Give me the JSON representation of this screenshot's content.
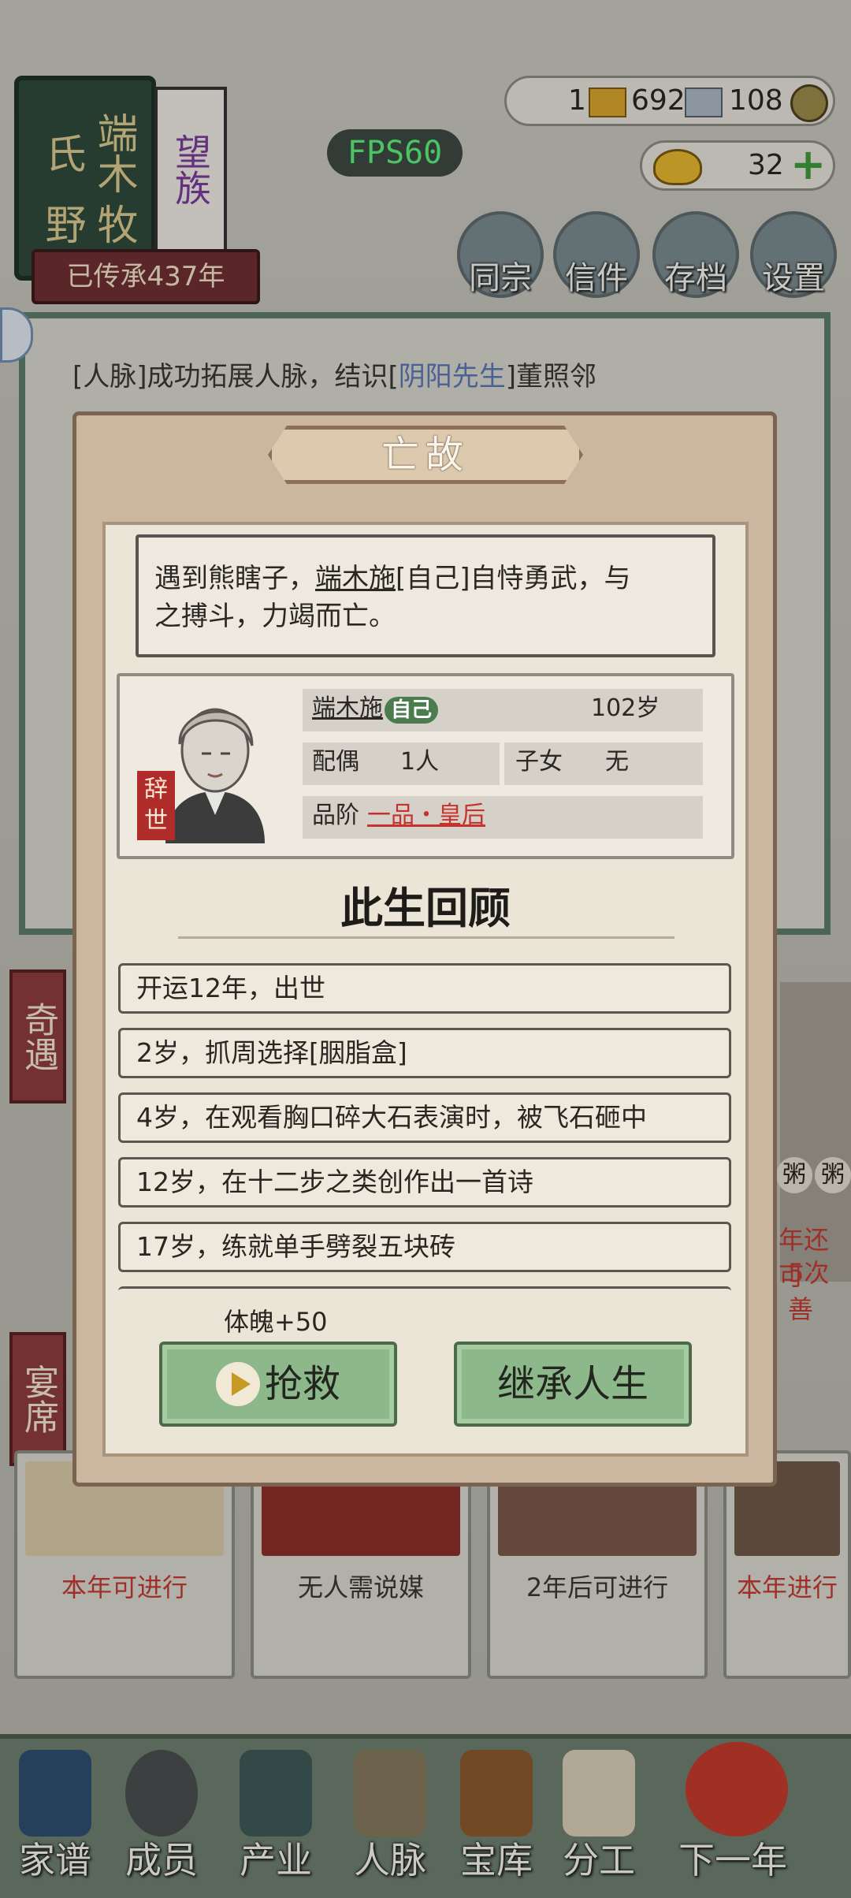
{
  "family": {
    "surname": "端木氏",
    "place": "牧野",
    "rank": "望族",
    "heritage": "已传承437年"
  },
  "fps": "FPS60",
  "resources": {
    "gold_bars": "1",
    "silver": "692",
    "copper": "108",
    "ingots": "32"
  },
  "top_buttons": [
    "同宗",
    "信件",
    "存档",
    "设置"
  ],
  "log": {
    "prefix": "[人脉]成功拓展人脉，结识[",
    "highlight": "阴阳先生",
    "suffix": "]董照邻"
  },
  "side_tabs": [
    "奇遇",
    "宴席"
  ],
  "bg_cards": [
    {
      "text": "本年可进行"
    },
    {
      "text": "无人需说媒"
    },
    {
      "text": "2年后可进行"
    },
    {
      "text": "本年进行"
    }
  ],
  "bg_snippets": {
    "right_top": "年还可",
    "right_bottom": "5次善",
    "right_badge_1": "粥",
    "right_badge_2": "粥"
  },
  "nav": [
    "家谱",
    "成员",
    "产业",
    "人脉",
    "宝库",
    "分工",
    "下一年"
  ],
  "modal": {
    "title": "亡故",
    "death": {
      "line1_a": "遇到熊瞎子，",
      "name": "端木施",
      "line1_b": "[自己]自恃勇武，与",
      "line2": "之搏斗，力竭而亡。"
    },
    "profile": {
      "status_stamp": "辞世",
      "name": "端木施",
      "self_tag": "自己",
      "age": "102岁",
      "spouse_label": "配偶",
      "spouse_value": "1人",
      "children_label": "子女",
      "children_value": "无",
      "rank_label": "品阶",
      "rank_value": "一品・皇后"
    },
    "review_title": "此生回顾",
    "life_events": [
      "开运12年，出世",
      "2岁，抓周选择[胭脂盒]",
      "4岁，在观看胸口碎大石表演时，被飞石砸中",
      "12岁，在十二步之类创作出一首诗",
      "17岁，练就单手劈裂五块砖"
    ],
    "bonus": "体魄+50",
    "rescue_label": "抢救",
    "inherit_label": "继承人生"
  }
}
